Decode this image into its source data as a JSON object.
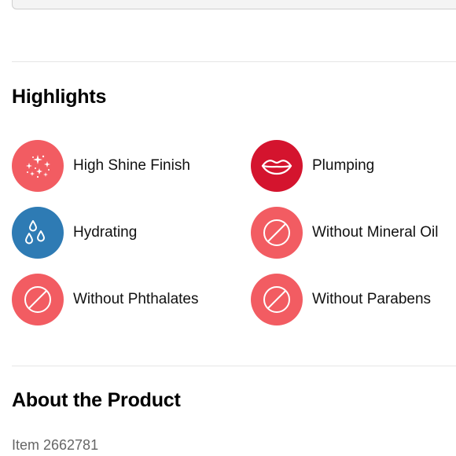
{
  "highlights": {
    "title": "Highlights",
    "items": [
      {
        "label": "High Shine Finish",
        "icon": "sparkles-icon",
        "color": "#f25c62"
      },
      {
        "label": "Plumping",
        "icon": "lips-icon",
        "color": "#d4142e"
      },
      {
        "label": "Hydrating",
        "icon": "water-drops-icon",
        "color": "#2e7bb4"
      },
      {
        "label": "Without Mineral Oil",
        "icon": "prohibited-icon",
        "color": "#f25c62"
      },
      {
        "label": "Without Phthalates",
        "icon": "prohibited-icon",
        "color": "#f25c62"
      },
      {
        "label": "Without Parabens",
        "icon": "prohibited-icon",
        "color": "#f25c62"
      }
    ]
  },
  "about": {
    "title": "About the Product",
    "item_number": "Item 2662781"
  }
}
